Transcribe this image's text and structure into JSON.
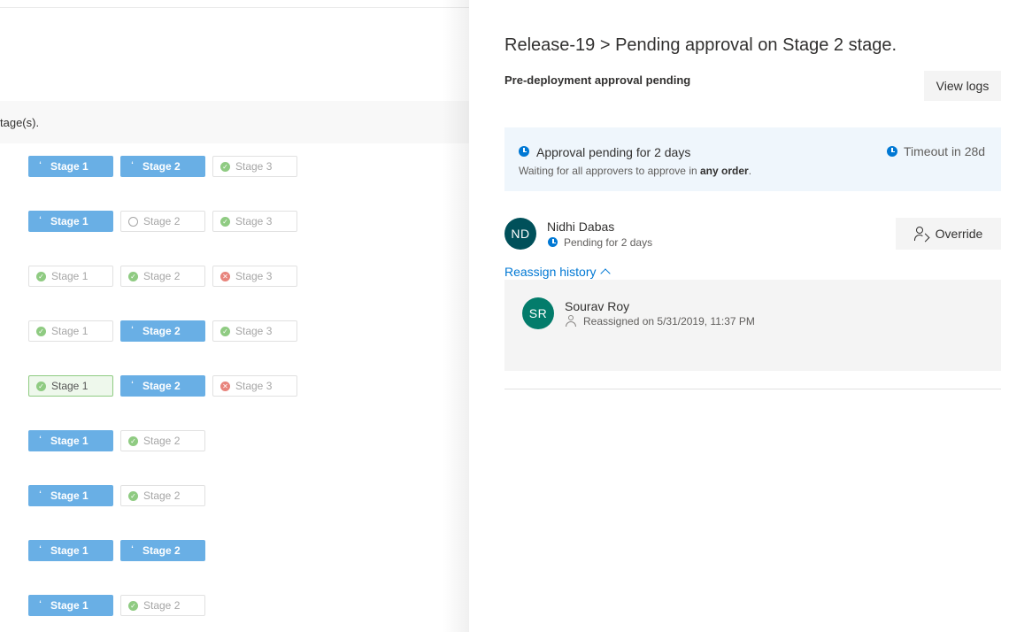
{
  "left": {
    "info_text": "tage(s).",
    "rows": [
      [
        {
          "label": "Stage 1",
          "status": "pending"
        },
        {
          "label": "Stage 2",
          "status": "pending"
        },
        {
          "label": "Stage 3",
          "status": "success"
        }
      ],
      [
        {
          "label": "Stage 1",
          "status": "pending"
        },
        {
          "label": "Stage 2",
          "status": "notstarted"
        },
        {
          "label": "Stage 3",
          "status": "success"
        }
      ],
      [
        {
          "label": "Stage 1",
          "status": "success"
        },
        {
          "label": "Stage 2",
          "status": "success"
        },
        {
          "label": "Stage 3",
          "status": "failed"
        }
      ],
      [
        {
          "label": "Stage 1",
          "status": "success"
        },
        {
          "label": "Stage 2",
          "status": "pending"
        },
        {
          "label": "Stage 3",
          "status": "success"
        }
      ],
      [
        {
          "label": "Stage 1",
          "status": "success-highlight"
        },
        {
          "label": "Stage 2",
          "status": "pending"
        },
        {
          "label": "Stage 3",
          "status": "failed"
        }
      ],
      [
        {
          "label": "Stage 1",
          "status": "pending"
        },
        {
          "label": "Stage 2",
          "status": "success"
        }
      ],
      [
        {
          "label": "Stage 1",
          "status": "pending"
        },
        {
          "label": "Stage 2",
          "status": "success"
        }
      ],
      [
        {
          "label": "Stage 1",
          "status": "pending"
        },
        {
          "label": "Stage 2",
          "status": "pending"
        }
      ],
      [
        {
          "label": "Stage 1",
          "status": "pending"
        },
        {
          "label": "Stage 2",
          "status": "success"
        }
      ]
    ]
  },
  "panel": {
    "title": "Release-19 > Pending approval on Stage 2 stage.",
    "subtitle": "Pre-deployment approval pending",
    "view_logs_label": "View logs",
    "approval": {
      "title": "Approval pending for 2 days",
      "desc_prefix": "Waiting for all approvers to approve in ",
      "desc_bold": "any order",
      "desc_suffix": ".",
      "timeout": "Timeout in 28d"
    },
    "approver": {
      "initials": "ND",
      "name": "Nidhi Dabas",
      "status": "Pending for 2 days"
    },
    "override_label": "Override",
    "reassign_history_label": "Reassign history",
    "history": {
      "initials": "SR",
      "name": "Sourav Roy",
      "detail": "Reassigned on 5/31/2019, 11:37 PM"
    }
  },
  "colors": {
    "accent": "#0078d4",
    "pending_pill": "#69afe5",
    "success": "#8fcb82",
    "failed": "#e8847c",
    "approval_bg": "#eff6fc",
    "avatar_nd": "#00505a",
    "avatar_sr": "#037c6b"
  },
  "icons": {
    "pending": "clock-icon",
    "success": "check-circle-icon",
    "failed": "x-circle-icon",
    "notstarted": "empty-circle-icon"
  }
}
